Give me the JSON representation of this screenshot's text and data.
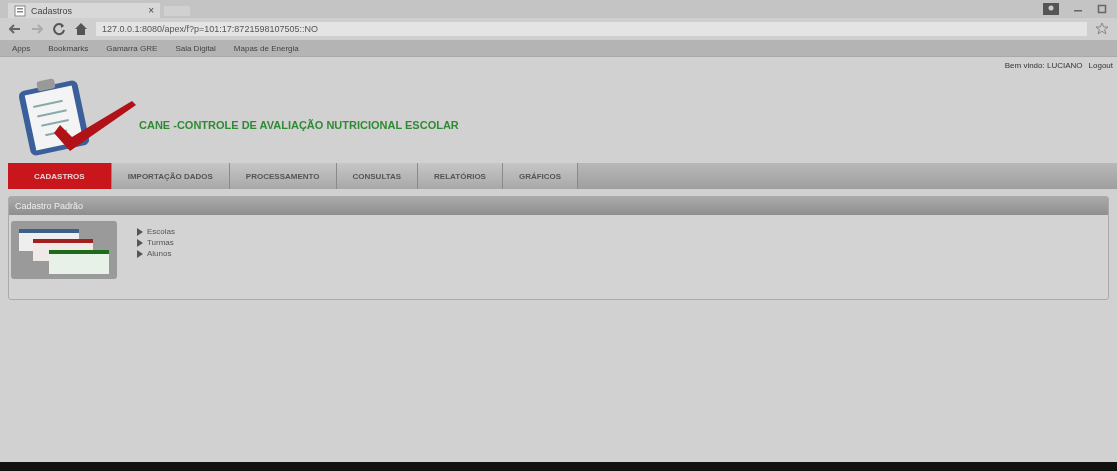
{
  "browser": {
    "tab_title": "Cadastros",
    "tab_close": "×",
    "url": "127.0.0.1:8080/apex/f?p=101:17:8721598107505::NO",
    "bookmarks": [
      {
        "label": "Apps"
      },
      {
        "label": "Bookmarks"
      },
      {
        "label": "Gamarra GRE"
      },
      {
        "label": "Sala Digital"
      },
      {
        "label": "Mapas de Energia"
      }
    ]
  },
  "header": {
    "title": "CANE -CONTROLE DE AVALIAÇÃO NUTRICIONAL ESCOLAR",
    "user": "Bem vindo: LUCIANO",
    "logout": "Logout"
  },
  "nav": [
    {
      "label": "CADASTROS",
      "selected": true
    },
    {
      "label": "IMPORTAÇÃO DADOS",
      "selected": false
    },
    {
      "label": "PROCESSAMENTO",
      "selected": false
    },
    {
      "label": "CONSULTAS",
      "selected": false
    },
    {
      "label": "RELATÓRIOS",
      "selected": false
    },
    {
      "label": "GRÁFICOS",
      "selected": false
    }
  ],
  "region": {
    "title": "Cadastro Padrão",
    "links": [
      {
        "label": "Escolas"
      },
      {
        "label": "Turmas"
      },
      {
        "label": "Alunos"
      }
    ]
  }
}
